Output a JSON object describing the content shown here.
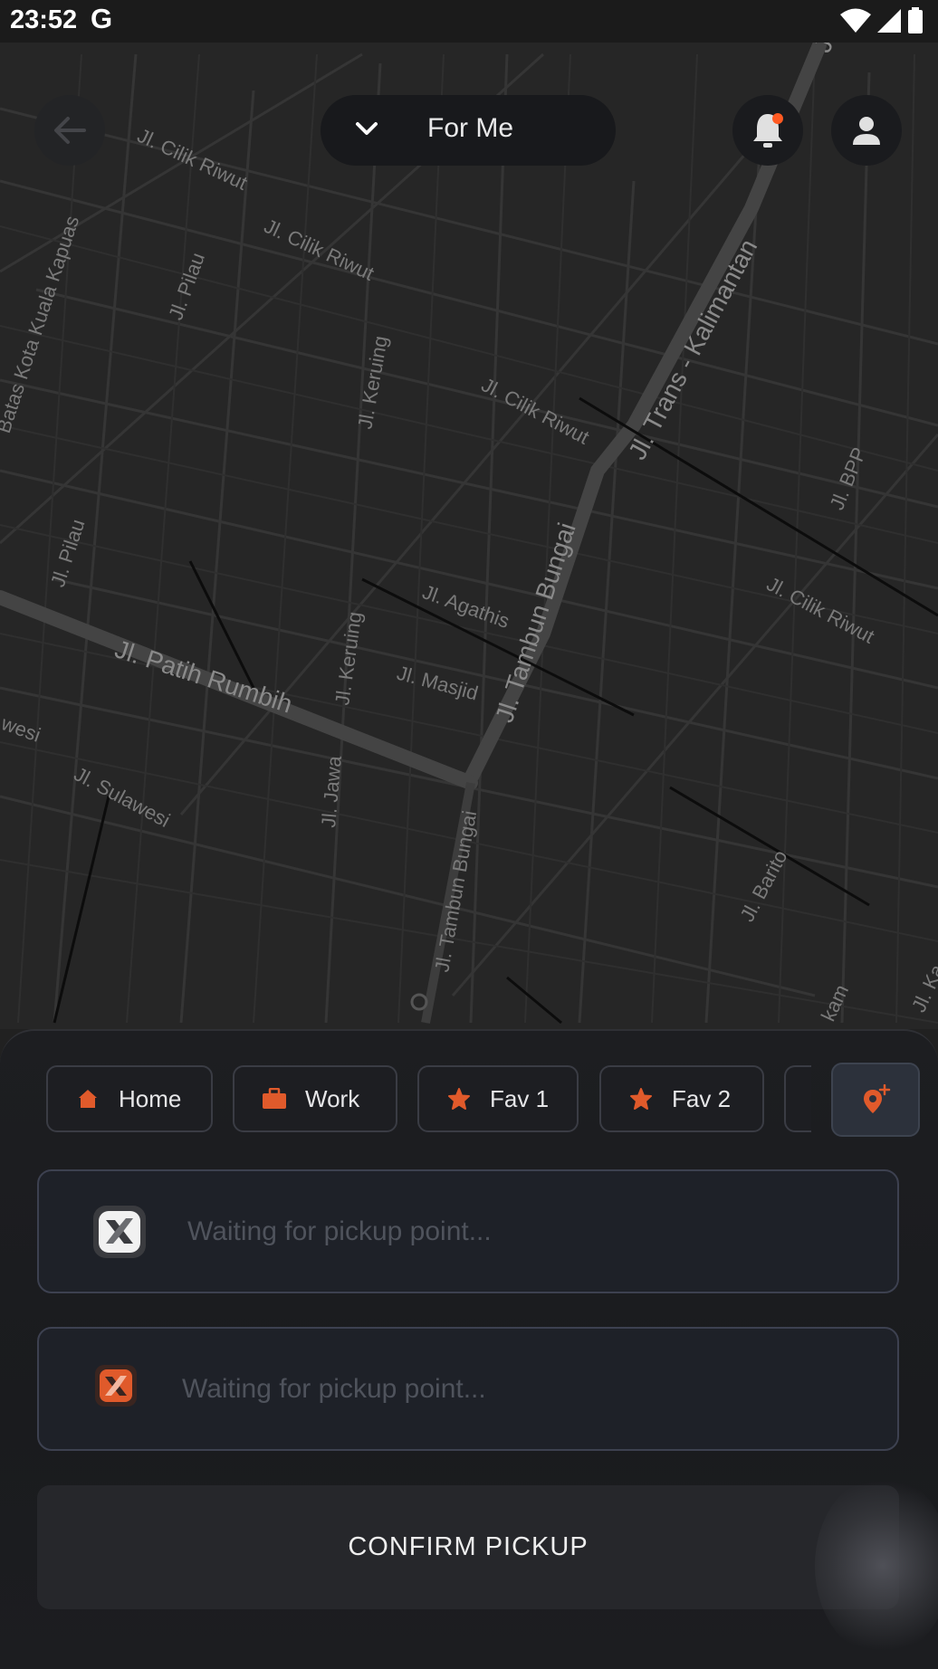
{
  "status_bar": {
    "time": "23:52",
    "google_badge": "G"
  },
  "header": {
    "rider_selector_label": "For Me"
  },
  "map": {
    "street_labels": [
      "Jl. Cilik Riwut",
      "Jl. Cilik Riwut",
      "Jl. Pilau",
      "Batas Kota Kuala Kapuas",
      "Jl. Keruing",
      "Jl. Cilik Riwut",
      "Jl. Trans - Kalimantan",
      "Jl. BPP",
      "Jl. Pilau",
      "Jl. Agathis",
      "Jl. Tambun Bungai",
      "Jl. Cilik Riwut",
      "Jl. Patih Rumbih",
      "Jl. Keruing",
      "Jl. Masjid",
      "Jl. Sulawesi",
      "Jl. Jawa",
      "Jl. Tambun Bungai",
      "Jl. Barito",
      "wesi",
      "kam",
      "Jl. Ka",
      "Jl. Tra"
    ]
  },
  "favorites": [
    {
      "label": "Home",
      "icon": "home-icon"
    },
    {
      "label": "Work",
      "icon": "briefcase-icon"
    },
    {
      "label": "Fav 1",
      "icon": "star-icon"
    },
    {
      "label": "Fav 2",
      "icon": "star-icon"
    }
  ],
  "pickup": {
    "placeholder": "Waiting for pickup point..."
  },
  "dropoff": {
    "placeholder": "Waiting for pickup point..."
  },
  "actions": {
    "confirm_label": "CONFIRM PICKUP"
  },
  "colors": {
    "accent": "#e05a2b",
    "background": "#1a1b1e",
    "notification": "#ff5a22"
  }
}
